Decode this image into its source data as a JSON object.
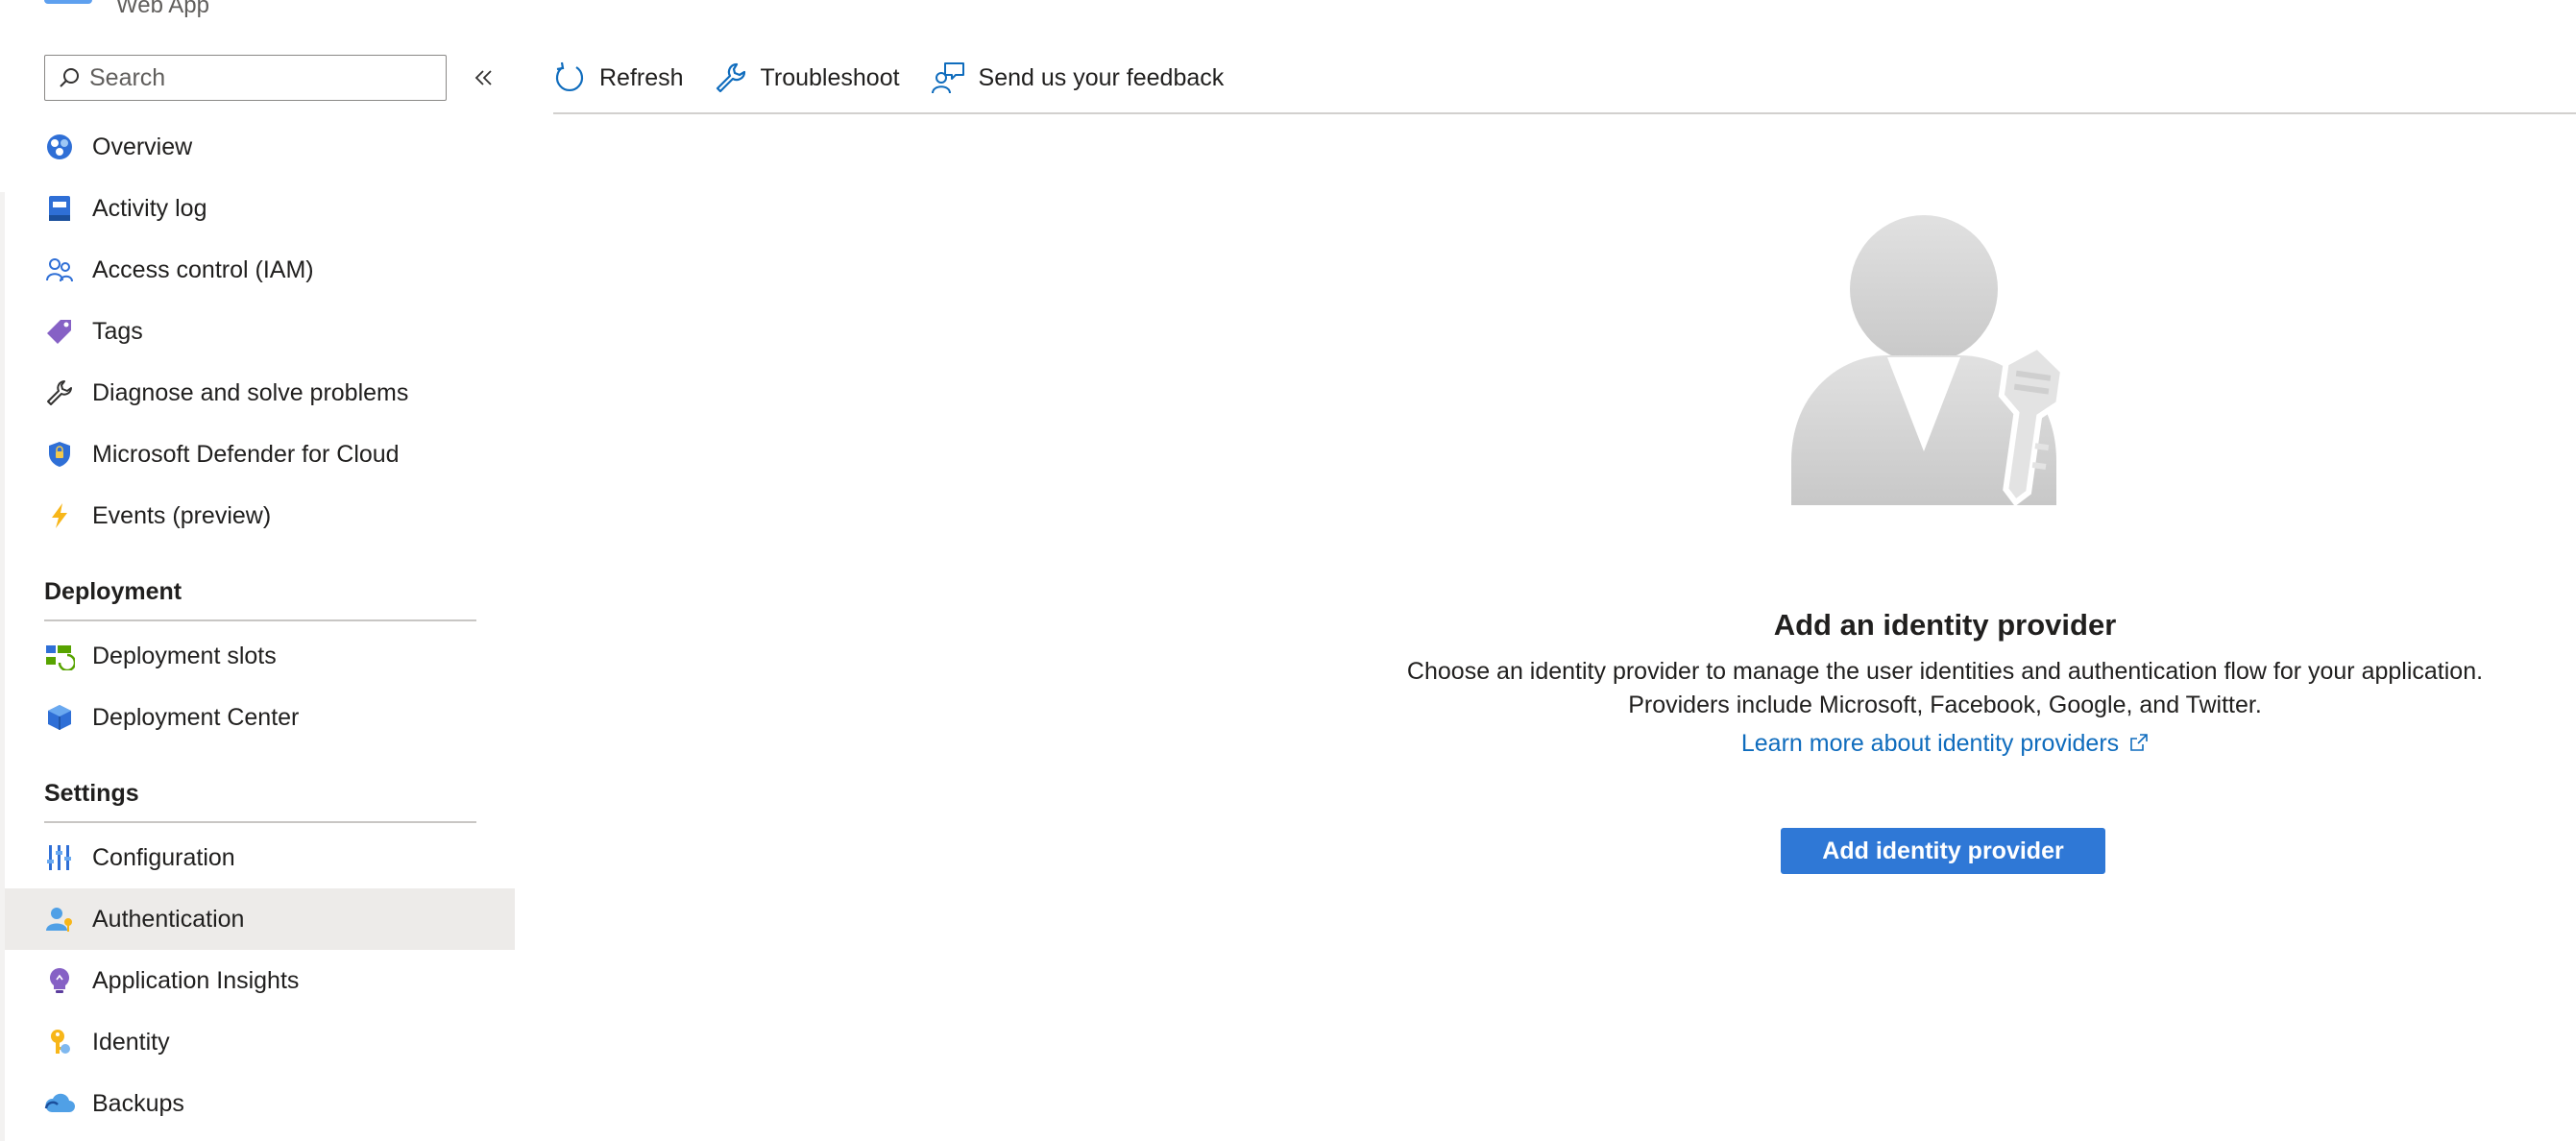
{
  "header": {
    "subtitle": "Web App"
  },
  "search": {
    "placeholder": "Search"
  },
  "nav": {
    "top_items": [
      {
        "label": "Overview",
        "icon": "overview-icon"
      },
      {
        "label": "Activity log",
        "icon": "activity-log-icon"
      },
      {
        "label": "Access control (IAM)",
        "icon": "access-control-icon"
      },
      {
        "label": "Tags",
        "icon": "tag-icon"
      },
      {
        "label": "Diagnose and solve problems",
        "icon": "wrench-icon"
      },
      {
        "label": "Microsoft Defender for Cloud",
        "icon": "shield-icon"
      },
      {
        "label": "Events (preview)",
        "icon": "lightning-icon"
      }
    ],
    "deployment": {
      "header": "Deployment",
      "items": [
        {
          "label": "Deployment slots",
          "icon": "deployment-slots-icon"
        },
        {
          "label": "Deployment Center",
          "icon": "deployment-center-icon"
        }
      ]
    },
    "settings": {
      "header": "Settings",
      "items": [
        {
          "label": "Configuration",
          "icon": "sliders-icon"
        },
        {
          "label": "Authentication",
          "icon": "user-key-icon",
          "selected": true
        },
        {
          "label": "Application Insights",
          "icon": "lightbulb-icon"
        },
        {
          "label": "Identity",
          "icon": "key-icon"
        },
        {
          "label": "Backups",
          "icon": "cloud-backup-icon"
        }
      ]
    }
  },
  "toolbar": {
    "refresh": "Refresh",
    "troubleshoot": "Troubleshoot",
    "feedback": "Send us your feedback"
  },
  "empty_state": {
    "title": "Add an identity provider",
    "description_line1": "Choose an identity provider to manage the user identities and authentication flow for your application.",
    "description_line2": "Providers include Microsoft, Facebook, Google, and Twitter.",
    "learn_more": "Learn more about identity providers",
    "button": "Add identity provider"
  },
  "colors": {
    "accent": "#2f78d6",
    "link": "#0f6cbd",
    "selected_bg": "#edebe9"
  }
}
